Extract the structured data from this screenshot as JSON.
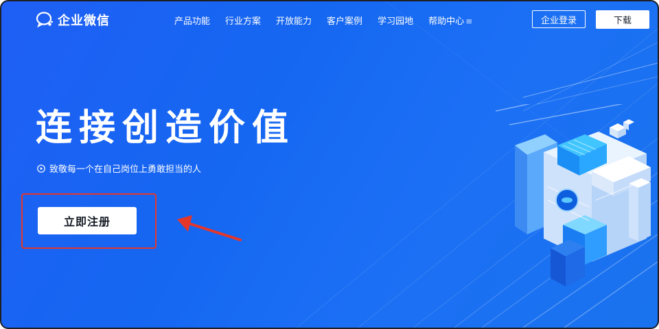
{
  "header": {
    "logo_text": "企业微信",
    "nav": [
      {
        "label": "产品功能"
      },
      {
        "label": "行业方案"
      },
      {
        "label": "开放能力"
      },
      {
        "label": "客户案例"
      },
      {
        "label": "学习园地"
      },
      {
        "label": "帮助中心",
        "icon": "menu-icon"
      }
    ],
    "menu_glyph": "≡",
    "login_label": "企业登录",
    "download_label": "下载"
  },
  "hero": {
    "title": "连接创造价值",
    "subtitle": "致敬每一个在自己岗位上勇敢担当的人",
    "subtitle_icon": "play-circle-icon",
    "register_label": "立即注册"
  },
  "annotation": {
    "highlight_color": "#e5362a",
    "arrow_color": "#e5362a"
  },
  "colors": {
    "background": "#1567f1",
    "text": "#ffffff",
    "button_bg": "#ffffff"
  }
}
